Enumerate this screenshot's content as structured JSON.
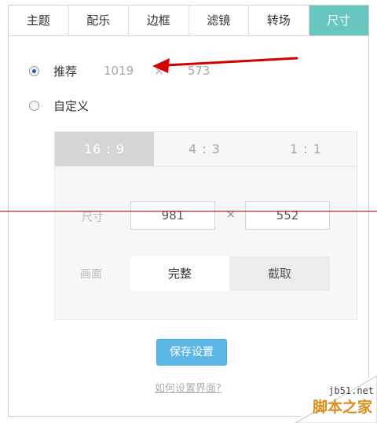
{
  "tabs": [
    {
      "label": "主题",
      "active": false
    },
    {
      "label": "配乐",
      "active": false
    },
    {
      "label": "边框",
      "active": false
    },
    {
      "label": "滤镜",
      "active": false
    },
    {
      "label": "转场",
      "active": false
    },
    {
      "label": "尺寸",
      "active": true
    }
  ],
  "size_option": {
    "recommended": {
      "label": "推荐",
      "width": "1019",
      "times": "×",
      "height": "573",
      "selected": true
    },
    "custom": {
      "label": "自定义",
      "selected": false
    }
  },
  "ratios": [
    {
      "label": "16 : 9",
      "active": true
    },
    {
      "label": "4 : 3",
      "active": false
    },
    {
      "label": "1 : 1",
      "active": false
    }
  ],
  "custom_panel": {
    "size_label": "尺寸",
    "width_value": "981",
    "times": "×",
    "height_value": "552",
    "picture_label": "画面",
    "picture_options": [
      {
        "label": "完整",
        "active": true
      },
      {
        "label": "截取",
        "active": false
      }
    ]
  },
  "save_button": "保存设置",
  "help_link": "如何设置界面?",
  "watermark": {
    "line1": "jb51.net",
    "line2": "脚本之家"
  },
  "colors": {
    "accent_tab": "#67c7be",
    "button": "#5cb7e6",
    "annotation": "#d40000"
  }
}
